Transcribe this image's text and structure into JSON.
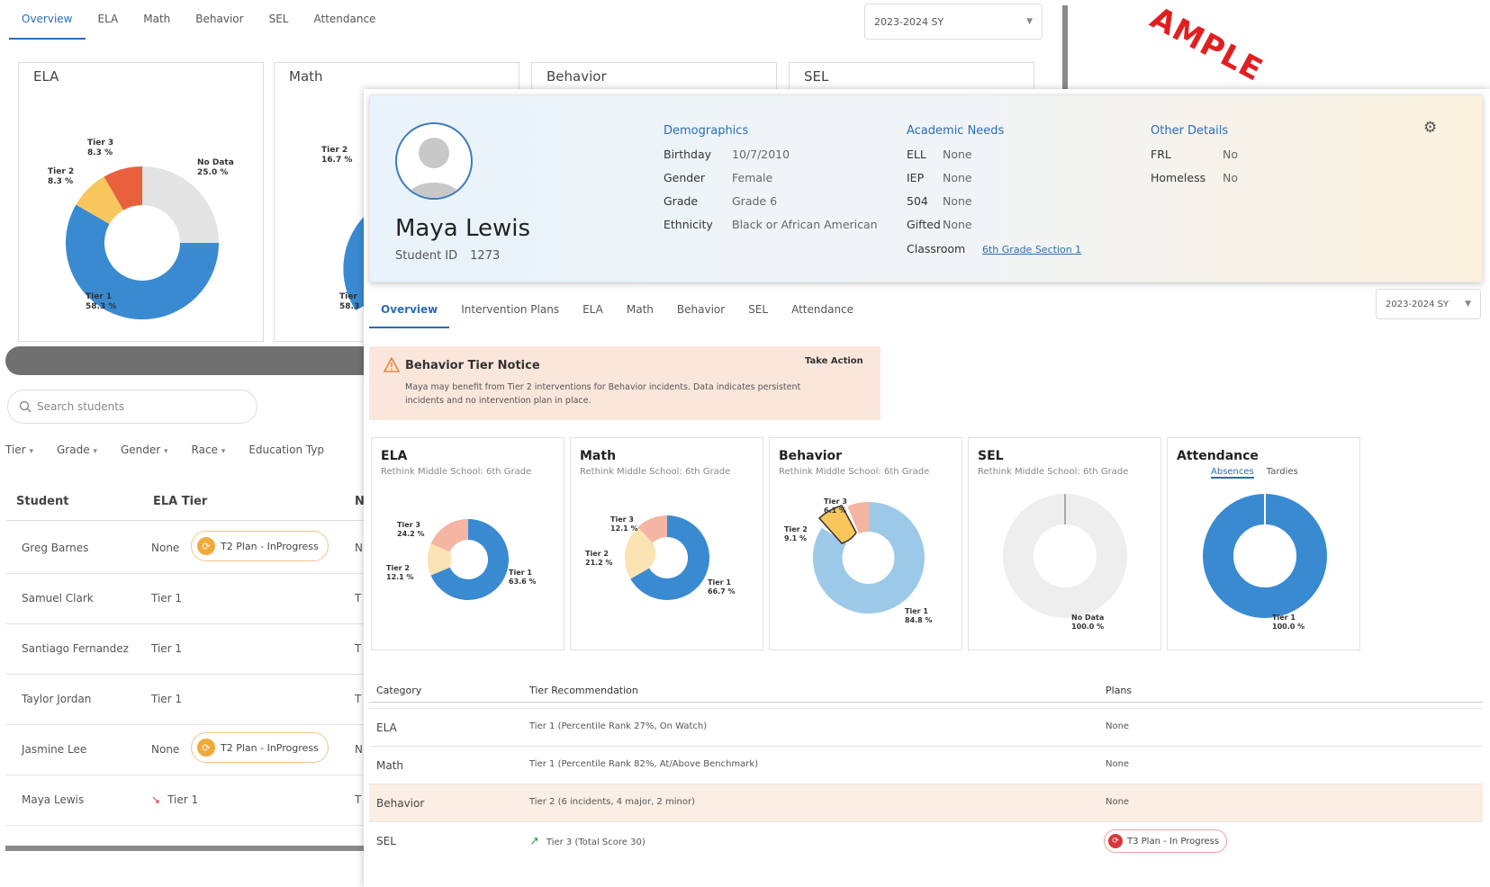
{
  "stamp": "AMPLE",
  "background": {
    "tabs": [
      "Overview",
      "ELA",
      "Math",
      "Behavior",
      "SEL",
      "Attendance"
    ],
    "school_year": "2023-2024 SY",
    "cards": [
      "ELA",
      "Math",
      "Behavior",
      "SEL"
    ],
    "ela_labels": {
      "t3": "Tier 3\n8.3 %",
      "t2": "Tier 2\n8.3 %",
      "nd": "No Data\n25.0 %",
      "t1": "Tier 1\n58.3 %"
    },
    "math_labels": {
      "t2": "Tier 2\n16.7 %",
      "t1": "Tier\n58.3"
    },
    "search_placeholder": "Search students",
    "filters": [
      "Tier",
      "Grade",
      "Gender",
      "Race",
      "Education Typ"
    ],
    "columns": {
      "student": "Student",
      "ela": "ELA Tier"
    },
    "rows": [
      {
        "name": "Greg Barnes",
        "tier": "None",
        "plan": "T2 Plan - InProgress",
        "extra": "N"
      },
      {
        "name": "Samuel Clark",
        "tier": "Tier 1",
        "plan": "",
        "extra": "T"
      },
      {
        "name": "Santiago Fernandez",
        "tier": "Tier 1",
        "plan": "",
        "extra": "T"
      },
      {
        "name": "Taylor Jordan",
        "tier": "Tier 1",
        "plan": "",
        "extra": "T"
      },
      {
        "name": "Jasmine Lee",
        "tier": "None",
        "plan": "T2 Plan - InProgress",
        "extra": "N"
      },
      {
        "name": "Maya Lewis",
        "tier": "Tier 1",
        "plan": "",
        "extra": "T"
      }
    ]
  },
  "student": {
    "name": "Maya Lewis",
    "id_label": "Student ID",
    "id": "1273",
    "demographics": {
      "title": "Demographics",
      "items": [
        [
          "Birthday",
          "10/7/2010"
        ],
        [
          "Gender",
          "Female"
        ],
        [
          "Grade",
          "Grade 6"
        ],
        [
          "Ethnicity",
          "Black or African American"
        ]
      ]
    },
    "academic": {
      "title": "Academic Needs",
      "items": [
        [
          "ELL",
          "None"
        ],
        [
          "IEP",
          "None"
        ],
        [
          "504",
          "None"
        ],
        [
          "Gifted",
          "None"
        ]
      ],
      "classroom_label": "Classroom",
      "classroom": "6th Grade Section 1"
    },
    "other": {
      "title": "Other Details",
      "items": [
        [
          "FRL",
          "No"
        ],
        [
          "Homeless",
          "No"
        ]
      ]
    }
  },
  "tabs": [
    "Overview",
    "Intervention Plans",
    "ELA",
    "Math",
    "Behavior",
    "SEL",
    "Attendance"
  ],
  "school_year": "2023-2024 SY",
  "notice": {
    "title": "Behavior Tier Notice",
    "action": "Take Action",
    "message": "Maya may benefit from Tier 2 interventions for Behavior incidents. Data indicates persistent incidents and no intervention plan in place."
  },
  "cards": [
    {
      "title": "ELA",
      "subtitle": "Rethink Middle School: 6th Grade",
      "labels": [
        "Tier 3\n24.2 %",
        "Tier 2\n12.1 %",
        "Tier 1\n63.6 %"
      ]
    },
    {
      "title": "Math",
      "subtitle": "Rethink Middle School: 6th Grade",
      "labels": [
        "Tier 3\n12.1 %",
        "Tier 2\n21.2 %",
        "Tier 1\n66.7 %"
      ]
    },
    {
      "title": "Behavior",
      "subtitle": "Rethink Middle School: 6th Grade",
      "labels": [
        "Tier 3\n6.1 %",
        "Tier 2\n9.1 %",
        "Tier 1\n84.8 %"
      ]
    },
    {
      "title": "SEL",
      "subtitle": "Rethink Middle School: 6th Grade",
      "labels": [
        "No Data\n100.0 %"
      ]
    },
    {
      "title": "Attendance",
      "subtabs": [
        "Absences",
        "Tardies"
      ],
      "labels": [
        "Tier 1\n100.0 %"
      ]
    }
  ],
  "table": {
    "headers": [
      "Category",
      "Tier Recommendation",
      "Plans"
    ],
    "rows": [
      {
        "category": "ELA",
        "rec": "Tier 1 (Percentile Rank 27%, On Watch)",
        "plans": "None"
      },
      {
        "category": "Math",
        "rec": "Tier 1 (Percentile Rank 82%, At/Above Benchmark)",
        "plans": "None"
      },
      {
        "category": "Behavior",
        "rec": "Tier 2 (6 incidents, 4 major, 2 minor)",
        "plans": "None"
      },
      {
        "category": "SEL",
        "rec": "Tier 3 (Total Score 30)",
        "plans": "T3 Plan - In Progress"
      }
    ]
  },
  "colors": {
    "accent": "#2a6db5",
    "tier1": "#3a8ad1",
    "tier1_light": "#9dc9e8",
    "tier2": "#f7c65c",
    "tier2_light": "#fbe3b3",
    "tier3": "#e8603c",
    "tier3_light": "#f4b5a2",
    "nodata": "#e5e5e5"
  }
}
